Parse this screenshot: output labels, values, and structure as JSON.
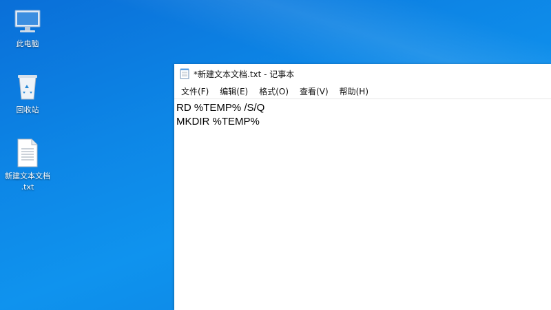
{
  "desktop": {
    "icons": [
      {
        "label": "此电脑",
        "icon": "computer-icon"
      },
      {
        "label": "回收站",
        "icon": "recycle-bin-icon"
      },
      {
        "label_line1": "新建文本文档",
        "label_line2": ".txt",
        "icon": "text-file-icon"
      }
    ]
  },
  "notepad": {
    "title": "*新建文本文档.txt - 记事本",
    "menu": [
      "文件(F)",
      "编辑(E)",
      "格式(O)",
      "查看(V)",
      "帮助(H)"
    ],
    "lines": [
      "RD %TEMP% /S/Q",
      "MKDIR %TEMP%"
    ]
  },
  "colors": {
    "desktop_background": "#0d86e6",
    "window_background": "#ffffff"
  }
}
